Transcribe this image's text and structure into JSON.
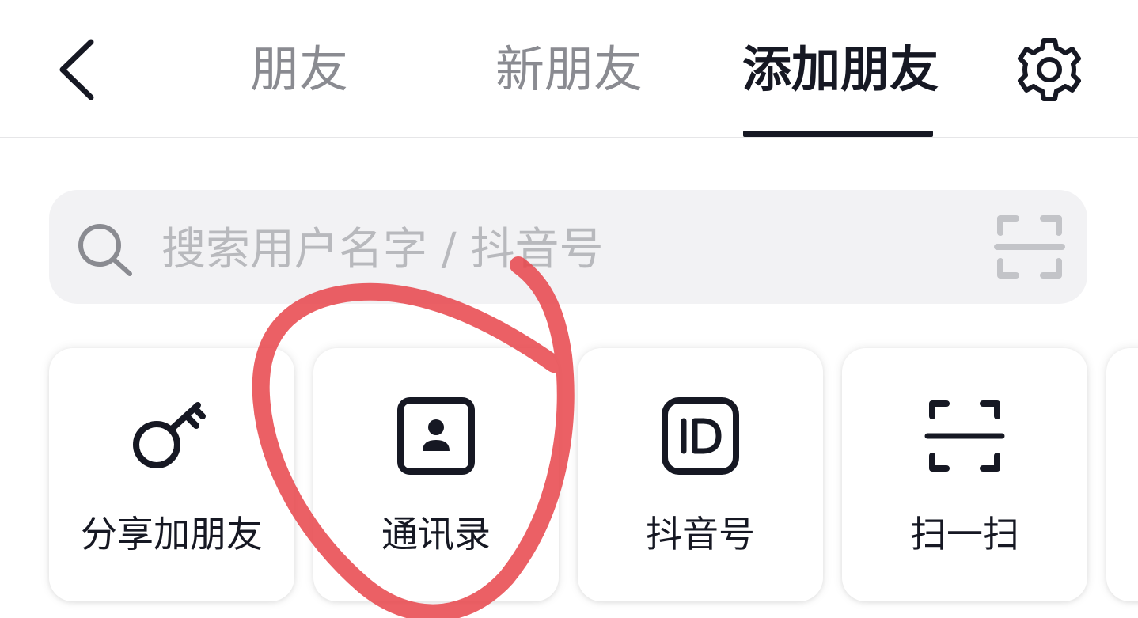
{
  "header": {
    "back_icon": "chevron-left-icon",
    "tabs": [
      {
        "label": "朋友",
        "active": false
      },
      {
        "label": "新朋友",
        "active": false
      },
      {
        "label": "添加朋友",
        "active": true
      }
    ],
    "settings_icon": "gear-icon"
  },
  "search": {
    "placeholder": "搜索用户名字 / 抖音号",
    "value": "",
    "search_icon": "search-icon",
    "scan_icon": "scan-icon"
  },
  "actions": [
    {
      "label": "分享加朋友",
      "icon": "key-icon"
    },
    {
      "label": "通讯录",
      "icon": "contacts-icon"
    },
    {
      "label": "抖音号",
      "icon": "id-icon"
    },
    {
      "label": "扫一扫",
      "icon": "scan-icon"
    }
  ],
  "annotation": {
    "color": "#e8444a",
    "target": "通讯录"
  },
  "colors": {
    "text_primary": "#161823",
    "text_secondary": "#8a8b91",
    "search_bg": "#f2f2f4",
    "placeholder": "#b8b9bd"
  }
}
